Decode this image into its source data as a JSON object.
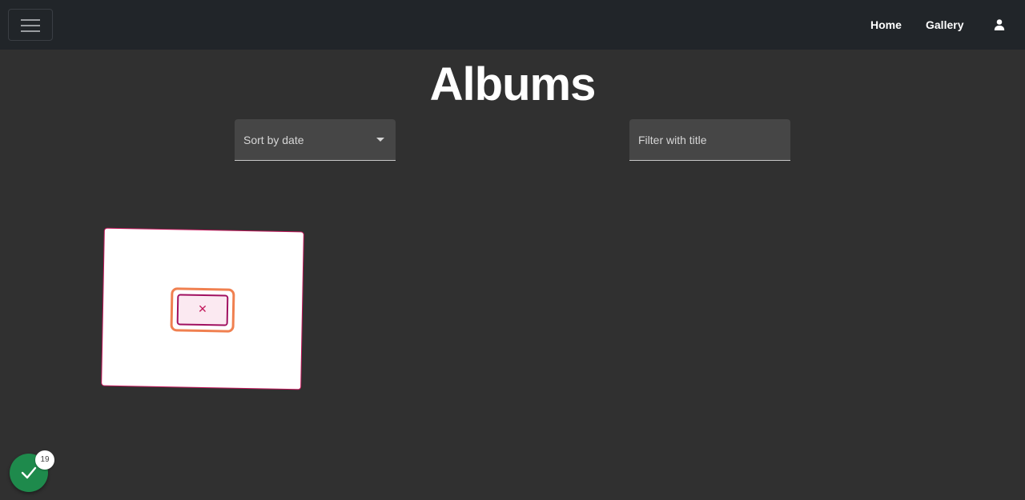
{
  "nav": {
    "links": [
      {
        "label": "Home"
      },
      {
        "label": "Gallery"
      }
    ],
    "menu_icon": "hamburger-icon",
    "account_icon": "user-icon"
  },
  "page": {
    "title": "Albums"
  },
  "controls": {
    "sort_label": "Sort by date",
    "filter_placeholder": "Filter with title"
  },
  "albums": [
    {
      "thumbnail": "broken-image-icon"
    }
  ],
  "status": {
    "icon": "checkmark-icon",
    "count": "19",
    "color": "#1e8a4c"
  },
  "colors": {
    "navbar": "#212529",
    "background": "#303030",
    "field": "#464646",
    "card_border": "#c2185b"
  }
}
